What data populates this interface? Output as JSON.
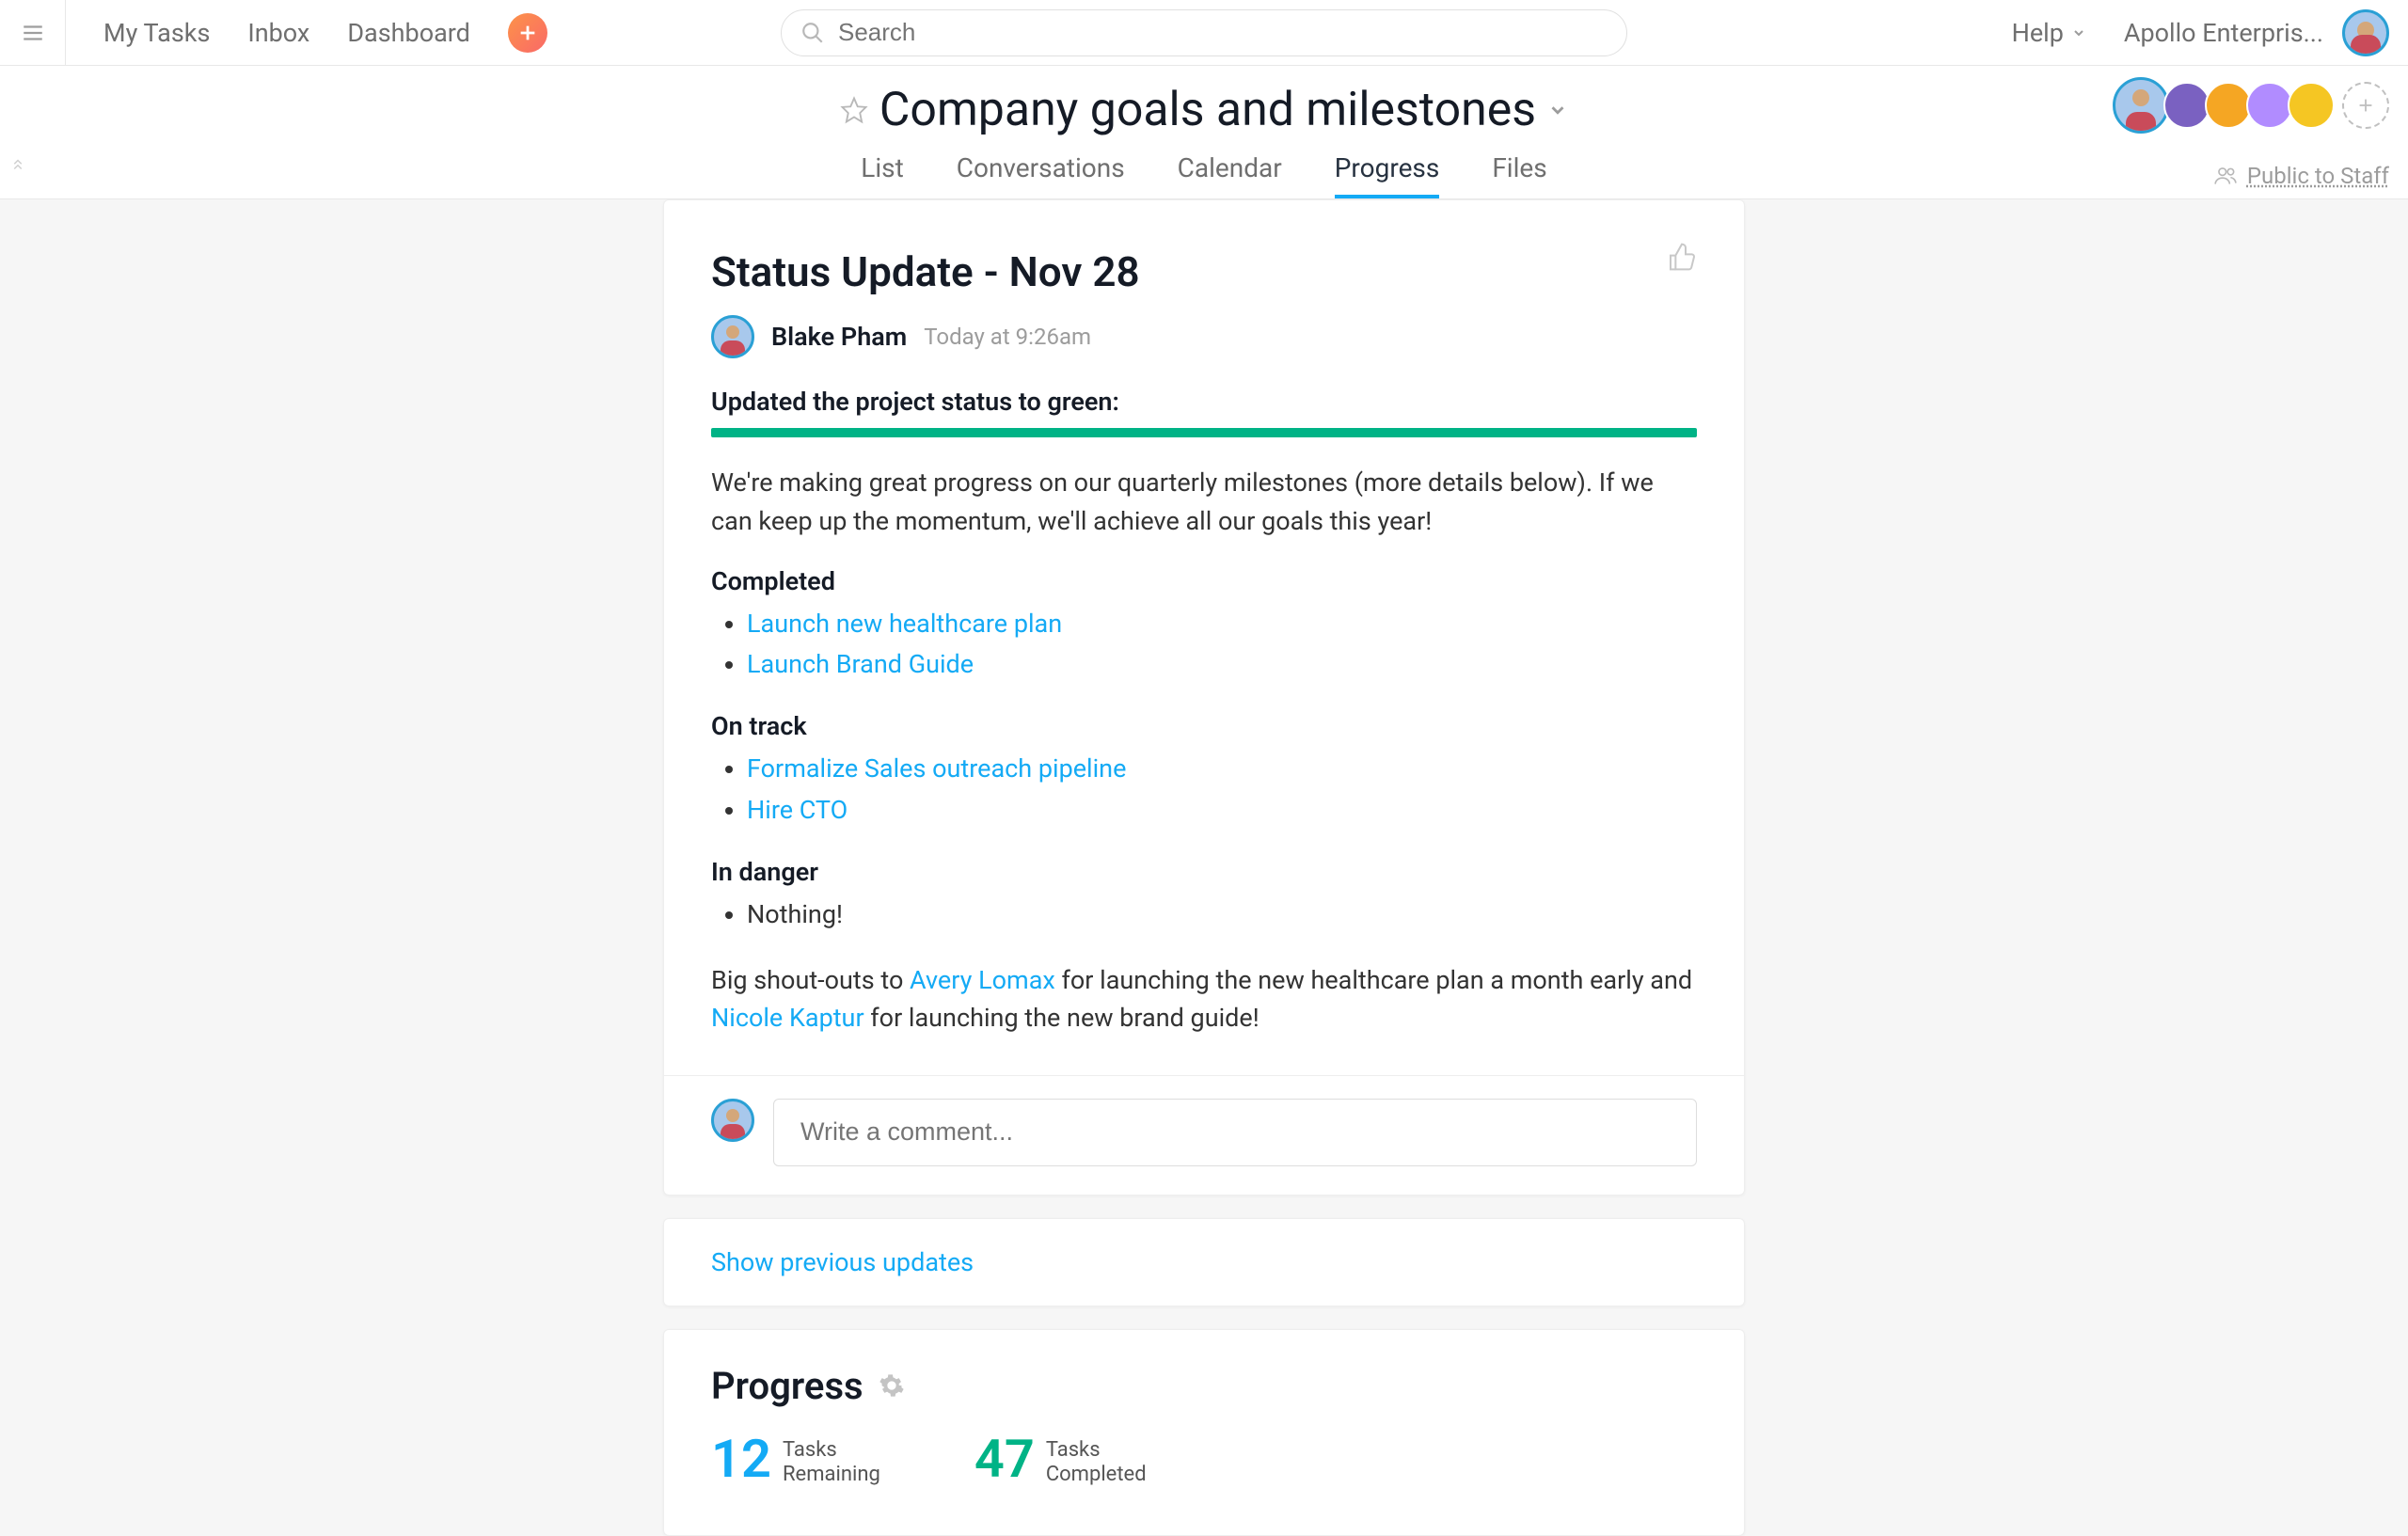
{
  "topbar": {
    "nav": {
      "my_tasks": "My Tasks",
      "inbox": "Inbox",
      "dashboard": "Dashboard"
    },
    "search_placeholder": "Search",
    "help": "Help",
    "org": "Apollo Enterpris..."
  },
  "project_header": {
    "title": "Company goals and milestones",
    "tabs": {
      "list": "List",
      "conversations": "Conversations",
      "calendar": "Calendar",
      "progress": "Progress",
      "files": "Files"
    },
    "visibility": "Public to Staff",
    "member_colors": [
      "#7a61c1",
      "#f5a623",
      "#b18cff",
      "#f5a623"
    ]
  },
  "status_update": {
    "title": "Status Update - Nov 28",
    "author": "Blake Pham",
    "timestamp": "Today at 9:26am",
    "status_line": "Updated the project status to green:",
    "body": "We're making great progress on our quarterly milestones (more details below). If we can keep up the momentum, we'll achieve all our goals this year!",
    "sections": {
      "completed": {
        "heading": "Completed",
        "items": [
          "Launch new healthcare plan",
          "Launch Brand Guide"
        ]
      },
      "on_track": {
        "heading": "On track",
        "items": [
          "Formalize Sales outreach pipeline",
          "Hire CTO"
        ]
      },
      "in_danger": {
        "heading": "In danger",
        "items": [
          "Nothing!"
        ]
      }
    },
    "shoutout": {
      "prefix": "Big shout-outs to ",
      "person1": "Avery Lomax",
      "mid1": " for launching the new healthcare plan a month early and ",
      "person2": "Nicole Kaptur",
      "suffix": " for launching the new brand guide!"
    }
  },
  "comment": {
    "placeholder": "Write a comment..."
  },
  "show_previous": "Show previous updates",
  "progress": {
    "title": "Progress",
    "remaining": {
      "count": "12",
      "l1": "Tasks",
      "l2": "Remaining"
    },
    "completed": {
      "count": "47",
      "l1": "Tasks",
      "l2": "Completed"
    }
  }
}
